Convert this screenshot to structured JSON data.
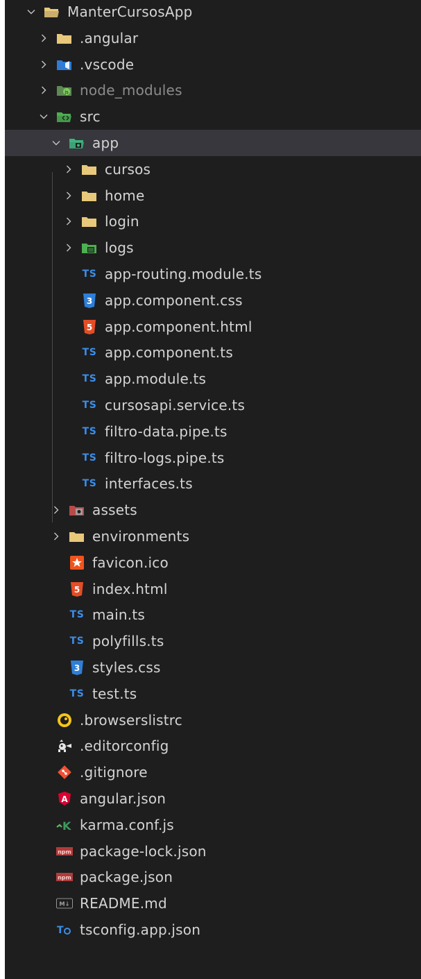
{
  "explorer": {
    "items": [
      {
        "label": "ManterCursosApp",
        "icon": "folder-open-icon",
        "chevron": "chevron-down-icon",
        "depth": 0
      },
      {
        "label": ".angular",
        "icon": "folder-icon",
        "chevron": "chevron-right-icon",
        "depth": 1
      },
      {
        "label": ".vscode",
        "icon": "vscode-folder-icon",
        "chevron": "chevron-right-icon",
        "depth": 1
      },
      {
        "label": "node_modules",
        "icon": "node-folder-icon",
        "chevron": "chevron-right-icon",
        "depth": 1,
        "dim": true
      },
      {
        "label": "src",
        "icon": "src-folder-open-icon",
        "chevron": "chevron-down-icon",
        "depth": 1
      },
      {
        "label": "app",
        "icon": "app-folder-open-icon",
        "chevron": "chevron-down-icon",
        "depth": 2,
        "selected": true
      },
      {
        "label": "cursos",
        "icon": "folder-icon",
        "chevron": "chevron-right-icon",
        "depth": 3
      },
      {
        "label": "home",
        "icon": "folder-icon",
        "chevron": "chevron-right-icon",
        "depth": 3
      },
      {
        "label": "login",
        "icon": "folder-icon",
        "chevron": "chevron-right-icon",
        "depth": 3
      },
      {
        "label": "logs",
        "icon": "logs-folder-icon",
        "chevron": "chevron-right-icon",
        "depth": 3
      },
      {
        "label": "app-routing.module.ts",
        "icon": "typescript-icon",
        "depth": 3
      },
      {
        "label": "app.component.css",
        "icon": "css-icon",
        "depth": 3
      },
      {
        "label": "app.component.html",
        "icon": "html-icon",
        "depth": 3
      },
      {
        "label": "app.component.ts",
        "icon": "typescript-icon",
        "depth": 3
      },
      {
        "label": "app.module.ts",
        "icon": "typescript-icon",
        "depth": 3
      },
      {
        "label": "cursosapi.service.ts",
        "icon": "typescript-icon",
        "depth": 3
      },
      {
        "label": "filtro-data.pipe.ts",
        "icon": "typescript-icon",
        "depth": 3
      },
      {
        "label": "filtro-logs.pipe.ts",
        "icon": "typescript-icon",
        "depth": 3
      },
      {
        "label": "interfaces.ts",
        "icon": "typescript-icon",
        "depth": 3
      },
      {
        "label": "assets",
        "icon": "assets-folder-icon",
        "chevron": "chevron-right-icon",
        "depth": 2
      },
      {
        "label": "environments",
        "icon": "folder-icon",
        "chevron": "chevron-right-icon",
        "depth": 2
      },
      {
        "label": "favicon.ico",
        "icon": "favicon-icon",
        "depth": 2
      },
      {
        "label": "index.html",
        "icon": "html-icon",
        "depth": 2
      },
      {
        "label": "main.ts",
        "icon": "typescript-icon",
        "depth": 2
      },
      {
        "label": "polyfills.ts",
        "icon": "typescript-icon",
        "depth": 2
      },
      {
        "label": "styles.css",
        "icon": "css-icon",
        "depth": 2
      },
      {
        "label": "test.ts",
        "icon": "typescript-icon",
        "depth": 2
      },
      {
        "label": ".browserslistrc",
        "icon": "browserslist-icon",
        "depth": 1
      },
      {
        "label": ".editorconfig",
        "icon": "editorconfig-icon",
        "depth": 1
      },
      {
        "label": ".gitignore",
        "icon": "git-icon",
        "depth": 1
      },
      {
        "label": "angular.json",
        "icon": "angular-icon",
        "depth": 1
      },
      {
        "label": "karma.conf.js",
        "icon": "karma-icon",
        "depth": 1
      },
      {
        "label": "package-lock.json",
        "icon": "npm-icon",
        "depth": 1
      },
      {
        "label": "package.json",
        "icon": "npm-icon",
        "depth": 1
      },
      {
        "label": "README.md",
        "icon": "markdown-icon",
        "depth": 1
      },
      {
        "label": "tsconfig.app.json",
        "icon": "tsconfig-icon",
        "depth": 1
      }
    ]
  },
  "colors": {
    "background": "#1e1e1e",
    "selected": "#37373d",
    "text": "#d4d4d4",
    "folder": "#e8c87a",
    "typescript": "#3b8eea",
    "css": "#2f7fd8",
    "html": "#e44d26",
    "angular": "#dd0031"
  },
  "glyphs": {
    "ts": "TS",
    "css": "3",
    "html": "5",
    "markdown": "M↓",
    "npm": "npm",
    "angular": "A",
    "karma": "K"
  }
}
